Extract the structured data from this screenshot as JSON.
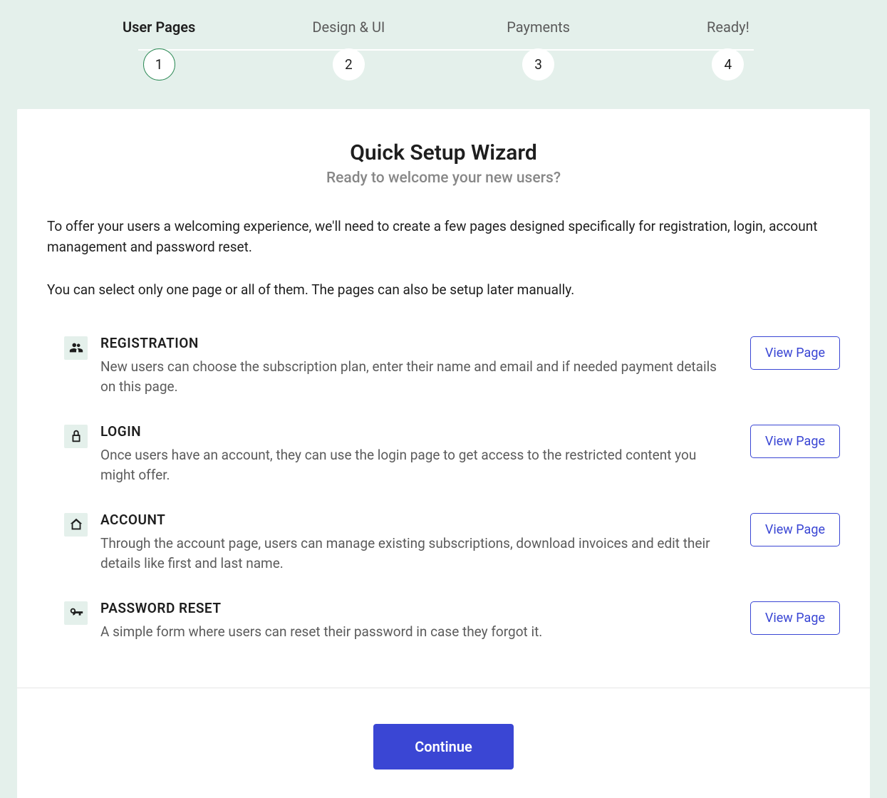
{
  "stepper": {
    "steps": [
      {
        "label": "User Pages",
        "number": "1",
        "active": true
      },
      {
        "label": "Design & UI",
        "number": "2",
        "active": false
      },
      {
        "label": "Payments",
        "number": "3",
        "active": false
      },
      {
        "label": "Ready!",
        "number": "4",
        "active": false
      }
    ]
  },
  "header": {
    "title": "Quick Setup Wizard",
    "subtitle": "Ready to welcome your new users?"
  },
  "intro": {
    "p1": "To offer your users a welcoming experience, we'll need to create a few pages designed specifically for registration, login, account management and password reset.",
    "p2": "You can select only one page or all of them. The pages can also be setup later manually."
  },
  "pages": [
    {
      "icon": "users-icon",
      "title": "REGISTRATION",
      "desc": "New users can choose the subscription plan, enter their name and email and if needed payment details on this page.",
      "action": "View Page"
    },
    {
      "icon": "lock-icon",
      "title": "LOGIN",
      "desc": "Once users have an account, they can use the login page to get access to the restricted content you might offer.",
      "action": "View Page"
    },
    {
      "icon": "home-icon",
      "title": "ACCOUNT",
      "desc": "Through the account page, users can manage existing subscriptions, download invoices and edit their details like first and last name.",
      "action": "View Page"
    },
    {
      "icon": "key-icon",
      "title": "PASSWORD RESET",
      "desc": "A simple form where users can reset their password in case they forgot it.",
      "action": "View Page"
    }
  ],
  "buttons": {
    "continue": "Continue"
  }
}
